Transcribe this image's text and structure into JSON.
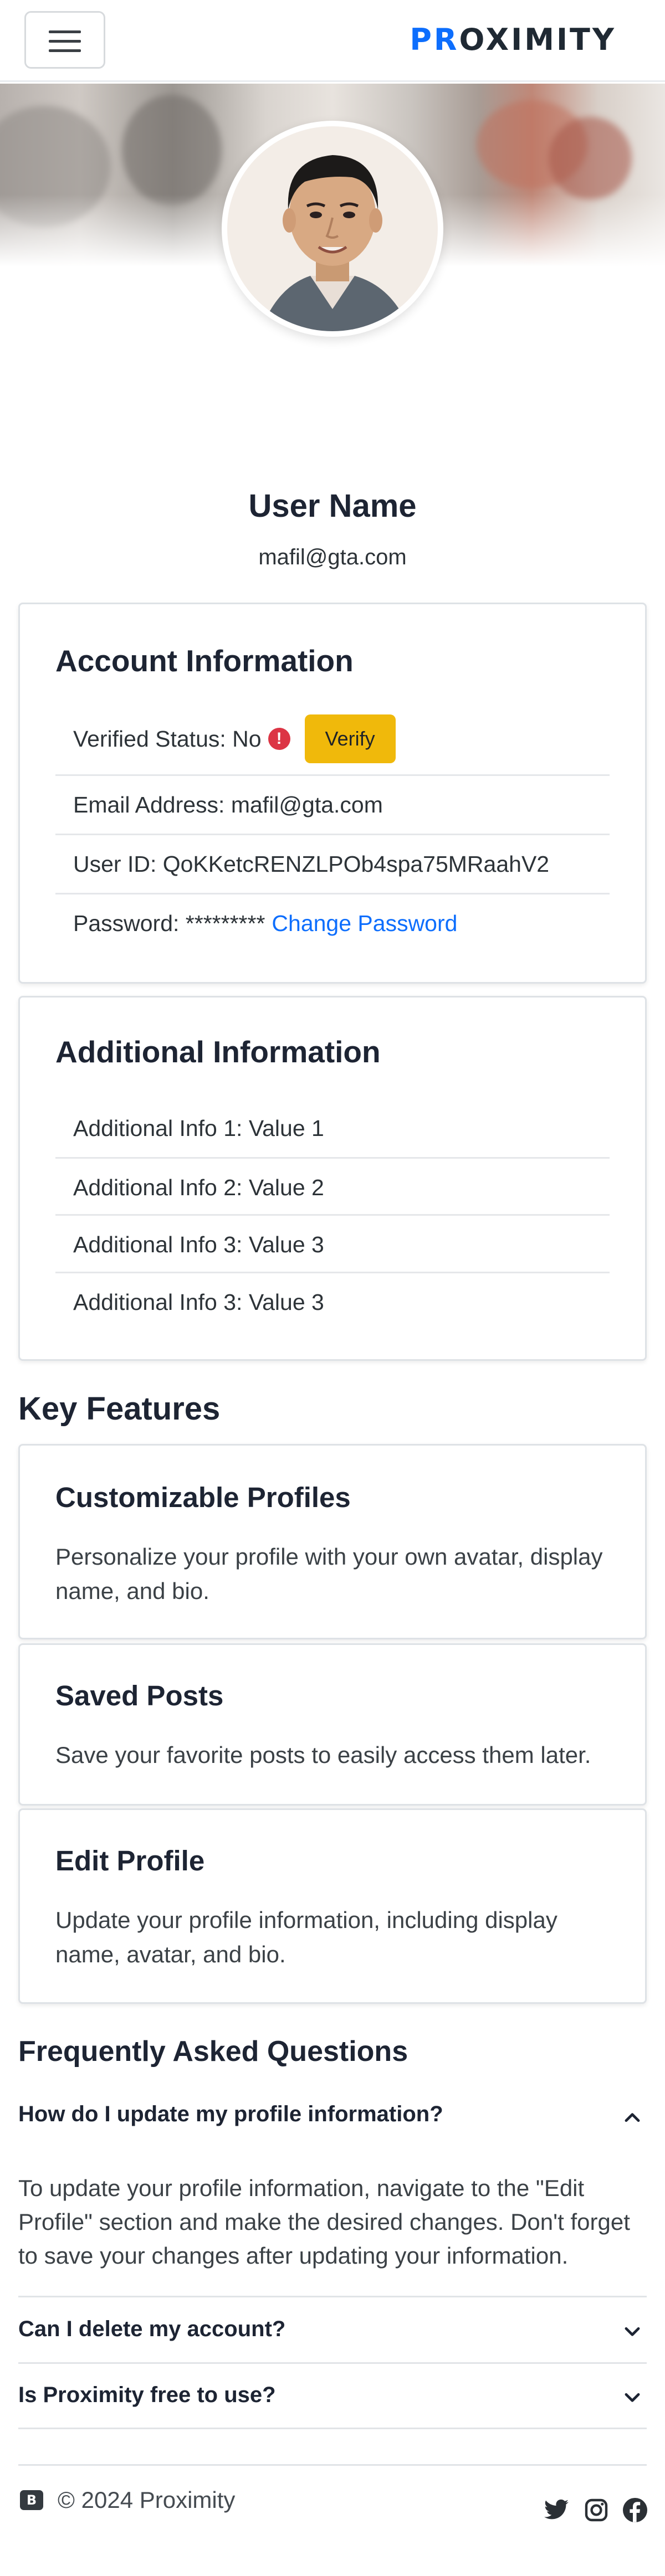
{
  "navbar": {
    "brand_accent": "PR",
    "brand_rest": "OXIMITY",
    "toggler_label": "Toggle navigation"
  },
  "profile": {
    "name": "User Name",
    "email": "mafil@gta.com"
  },
  "account": {
    "title": "Account Information",
    "verified_label": "Verified Status: No",
    "verified_icon": "!",
    "verify_button": "Verify",
    "email_line": "Email Address: mafil@gta.com",
    "userid_line": "User ID: QoKKetcRENZLPOb4spa75MRaahV2",
    "password_line": "Password: *********",
    "change_password": "Change Password"
  },
  "additional": {
    "title": "Additional Information",
    "items": [
      "Additional Info 1: Value 1",
      "Additional Info 2: Value 2",
      "Additional Info 3: Value 3",
      "Additional Info 3: Value 3"
    ]
  },
  "features": {
    "heading": "Key Features",
    "items": [
      {
        "title": "Customizable Profiles",
        "text": "Personalize your profile with your own avatar, display name, and bio."
      },
      {
        "title": "Saved Posts",
        "text": "Save your favorite posts to easily access them later."
      },
      {
        "title": "Edit Profile",
        "text": "Update your profile information, including display name, avatar, and bio."
      }
    ]
  },
  "faq": {
    "heading": "Frequently Asked Questions",
    "items": [
      {
        "question": "How do I update my profile information?",
        "answer": "To update your profile information, navigate to the \"Edit Profile\" section and make the desired changes. Don't forget to save your changes after updating your information.",
        "expanded": true
      },
      {
        "question": "Can I delete my account?",
        "expanded": false
      },
      {
        "question": "Is Proximity free to use?",
        "expanded": false
      }
    ]
  },
  "footer": {
    "logo_letter": "B",
    "copyright": "© 2024 Proximity",
    "social": [
      "twitter-icon",
      "instagram-icon",
      "facebook-icon"
    ]
  },
  "colors": {
    "accent": "#0d6efd",
    "verify_button": "#f0b90b",
    "warning": "#dc3545",
    "heading": "#1d2433"
  }
}
